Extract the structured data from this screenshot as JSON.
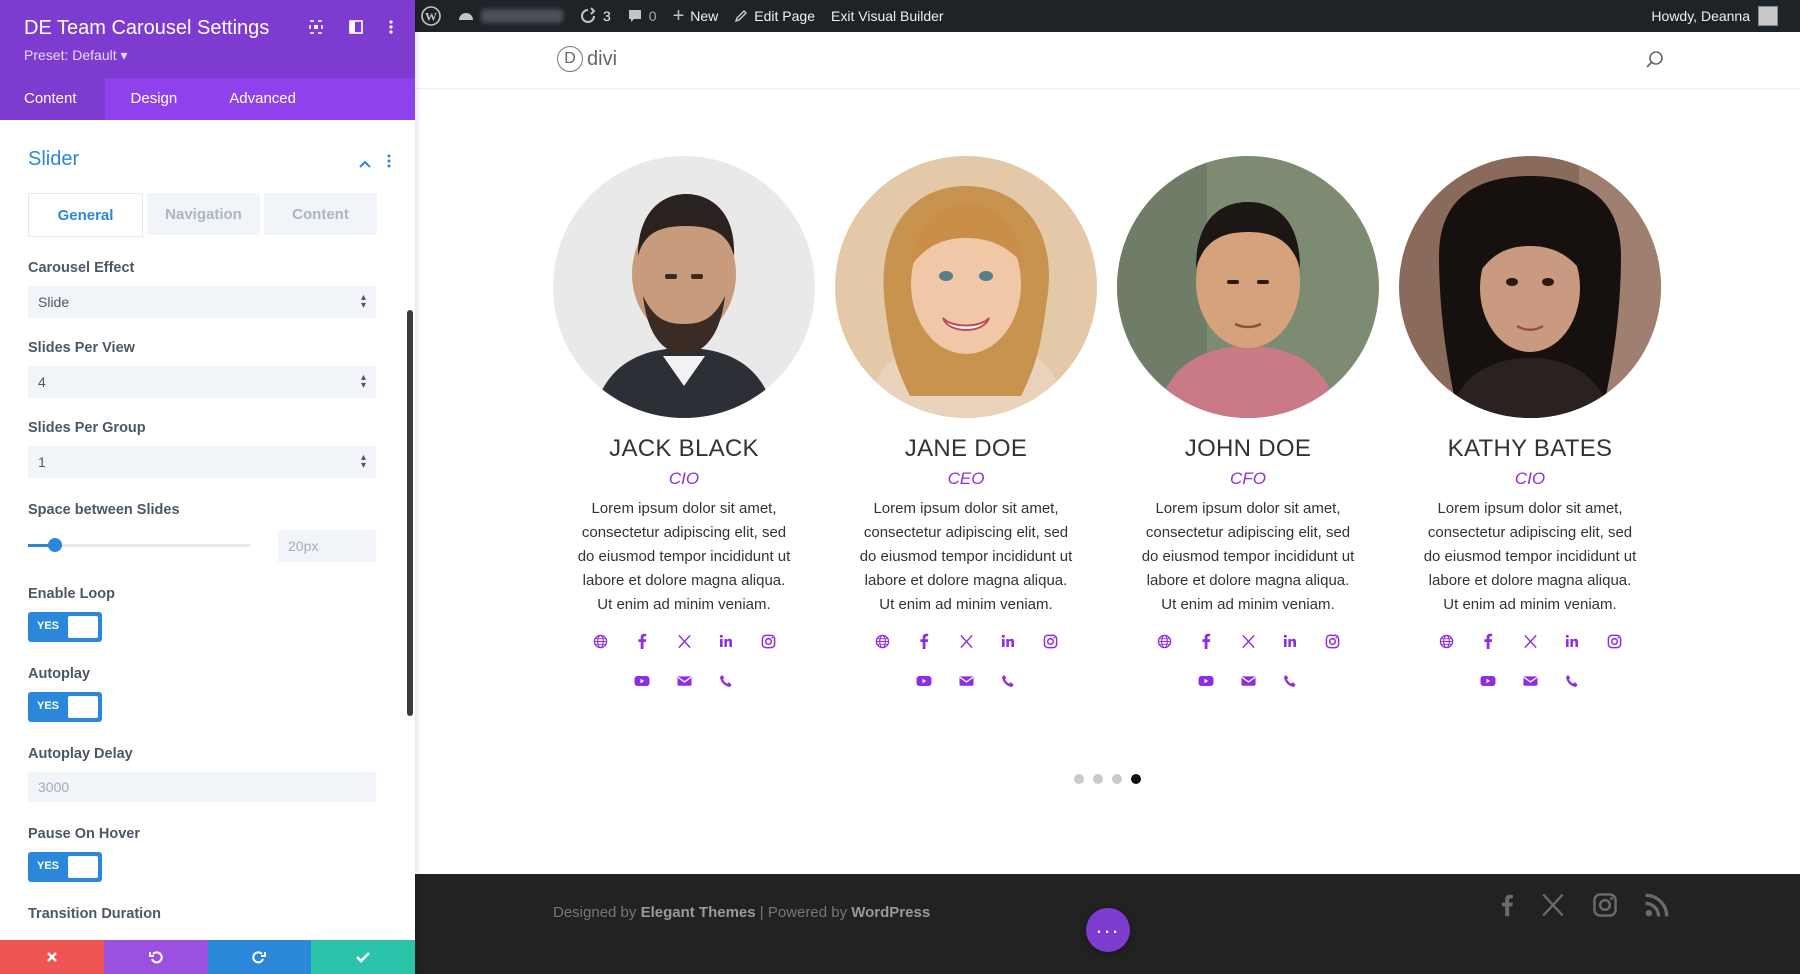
{
  "adminbar": {
    "updates_count": "3",
    "comments_count": "0",
    "new_label": "New",
    "edit_label": "Edit Page",
    "exit_label": "Exit Visual Builder",
    "howdy": "Howdy, Deanna"
  },
  "panel": {
    "title": "DE Team Carousel Settings",
    "preset": "Preset: Default ▾",
    "tabs": [
      {
        "label": "Content"
      },
      {
        "label": "Design"
      },
      {
        "label": "Advanced"
      }
    ],
    "section_title": "Slider",
    "subtabs": [
      {
        "label": "General"
      },
      {
        "label": "Navigation"
      },
      {
        "label": "Content"
      }
    ],
    "fields": {
      "carousel_effect": {
        "label": "Carousel Effect",
        "value": "Slide"
      },
      "slides_per_view": {
        "label": "Slides Per View",
        "value": "4"
      },
      "slides_per_group": {
        "label": "Slides Per Group",
        "value": "1"
      },
      "space_between": {
        "label": "Space between Slides",
        "value": "20px",
        "slider_fraction": 0.12
      },
      "enable_loop": {
        "label": "Enable Loop",
        "value": "YES"
      },
      "autoplay": {
        "label": "Autoplay",
        "value": "YES"
      },
      "autoplay_delay": {
        "label": "Autoplay Delay",
        "value": "3000"
      },
      "pause_on_hover": {
        "label": "Pause On Hover",
        "value": "YES"
      },
      "transition_duration": {
        "label": "Transition Duration"
      }
    }
  },
  "site": {
    "logo_text": "divi"
  },
  "team": [
    {
      "name": "JACK BLACK",
      "role": "CIO",
      "desc": "Lorem ipsum dolor sit amet, consectetur adipiscing elit, sed do eiusmod tempor incididunt ut labore et dolore magna aliqua. Ut enim ad minim veniam."
    },
    {
      "name": "JANE DOE",
      "role": "CEO",
      "desc": "Lorem ipsum dolor sit amet, consectetur adipiscing elit, sed do eiusmod tempor incididunt ut labore et dolore magna aliqua. Ut enim ad minim veniam."
    },
    {
      "name": "JOHN DOE",
      "role": "CFO",
      "desc": "Lorem ipsum dolor sit amet, consectetur adipiscing elit, sed do eiusmod tempor incididunt ut labore et dolore magna aliqua. Ut enim ad minim veniam."
    },
    {
      "name": "KATHY BATES",
      "role": "CIO",
      "desc": "Lorem ipsum dolor sit amet, consectetur adipiscing elit, sed do eiusmod tempor incididunt ut labore et dolore magna aliqua. Ut enim ad minim veniam."
    }
  ],
  "carousel": {
    "active_dot": 4,
    "dot_count": 4
  },
  "footer": {
    "designed_by": "Designed by",
    "elegant": "Elegant Themes",
    "separator": "|",
    "powered_by": "Powered by",
    "wordpress": "WordPress"
  },
  "colors": {
    "accent": "#8e2de2",
    "panel_header": "#7e3bd0",
    "blue": "#2b87da"
  }
}
